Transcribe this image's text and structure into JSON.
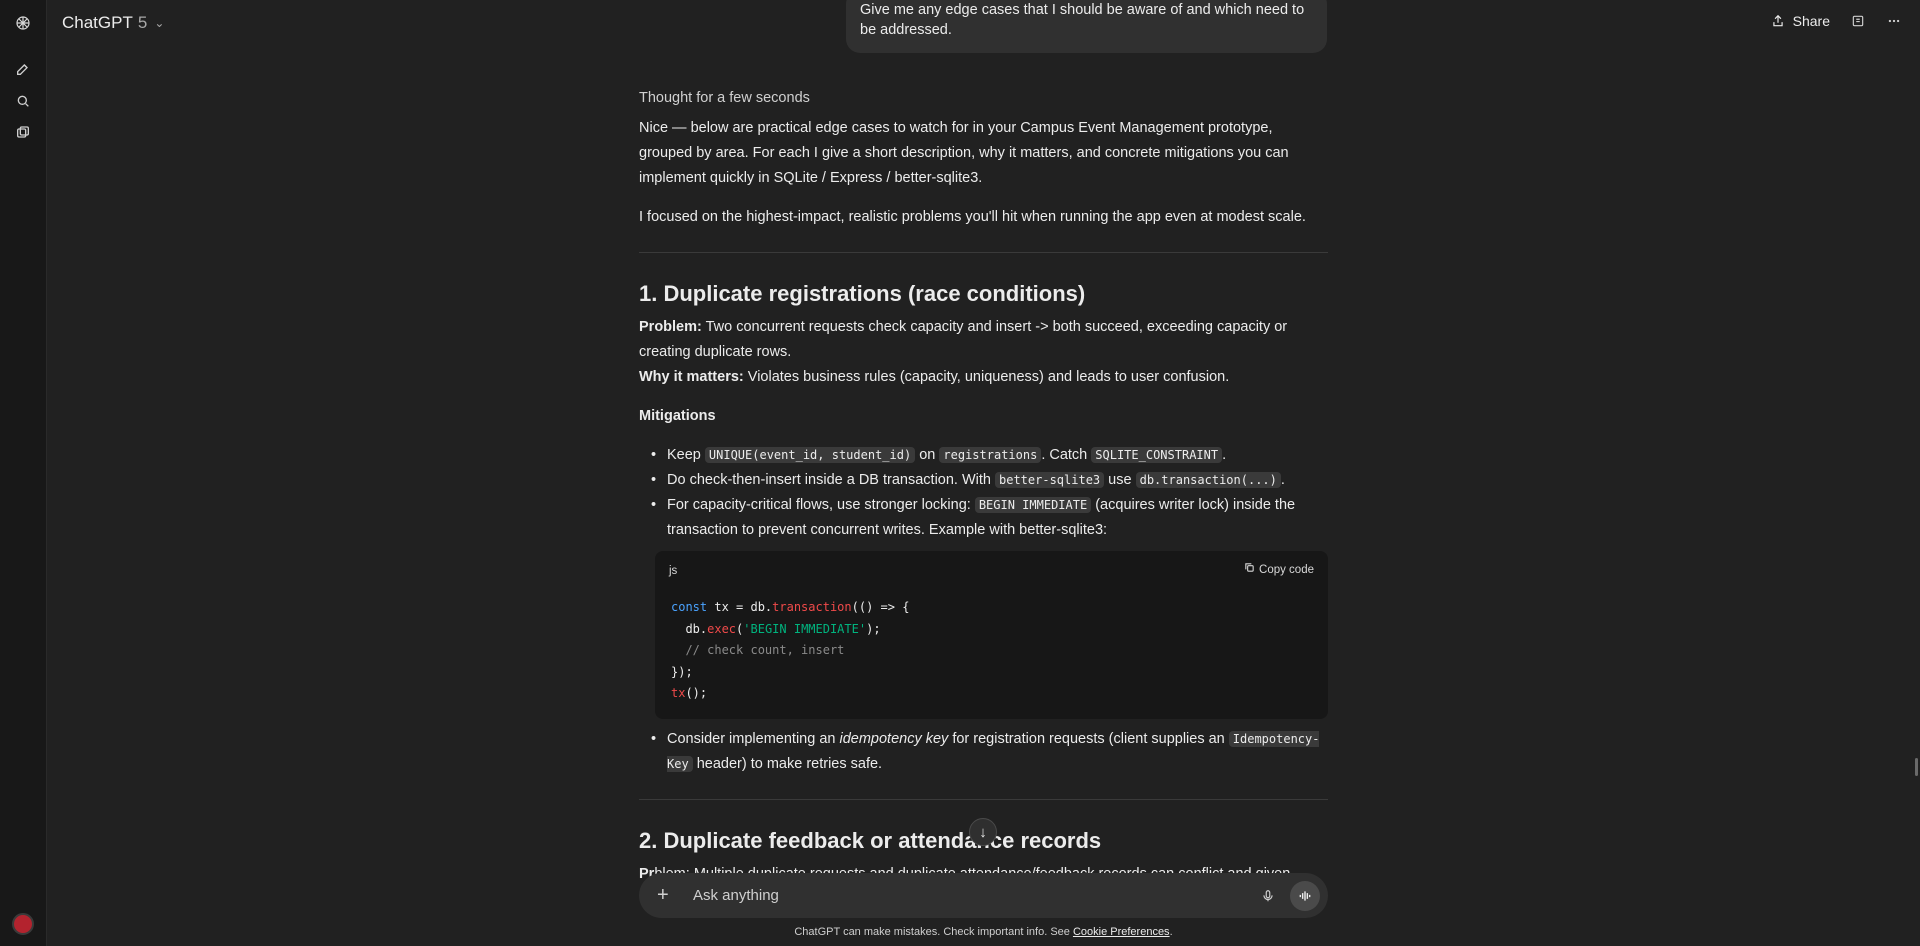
{
  "app": {
    "model_name": "ChatGPT",
    "model_version": "5"
  },
  "topbar": {
    "share_label": "Share"
  },
  "rail": {
    "icons": [
      "logo-icon",
      "new-chat-icon",
      "search-icon",
      "library-icon"
    ]
  },
  "user_message": "Give me any edge cases that I should be aware of and which need to be addressed.",
  "response": {
    "thought": "Thought for a few seconds",
    "intro": "Nice — below are practical edge cases to watch for in your Campus Event Management prototype, grouped by area. For each I give a short description, why it matters, and concrete mitigations you can implement quickly in SQLite / Express / better-sqlite3.",
    "focus": "I focused on the highest-impact, realistic problems you'll hit when running the app even at modest scale.",
    "section1": {
      "title": "1. Duplicate registrations (race conditions)",
      "problem_label": "Problem:",
      "problem_text": " Two concurrent requests check capacity and insert -> both succeed, exceeding capacity or creating duplicate rows.",
      "why_label": "Why it matters:",
      "why_text": " Violates business rules (capacity, uniqueness) and leads to user confusion.",
      "mitigations_label": "Mitigations",
      "b1": {
        "t1": "Keep ",
        "c1": "UNIQUE(event_id, student_id)",
        "t2": " on ",
        "c2": "registrations",
        "t3": ". Catch ",
        "c3": "SQLITE_CONSTRAINT",
        "t4": "."
      },
      "b2": {
        "t1": "Do check-then-insert inside a DB transaction. With ",
        "c1": "better-sqlite3",
        "t2": " use ",
        "c2": "db.transaction(...)",
        "t3": "."
      },
      "b3": {
        "t1": "For capacity-critical flows, use stronger locking: ",
        "c1": "BEGIN IMMEDIATE",
        "t2": " (acquires writer lock) inside the transaction to prevent concurrent writes. Example with better-sqlite3:"
      },
      "code": {
        "lang": "js",
        "copy_label": "Copy code",
        "l1_kw": "const",
        "l1_a": " tx = db.",
        "l1_fn": "transaction",
        "l1_b": "(() => {",
        "l2_a": "  db.",
        "l2_fn": "exec",
        "l2_b": "(",
        "l2_str": "'BEGIN IMMEDIATE'",
        "l2_c": ");",
        "l3_comment": "  // check count, insert",
        "l4": "});",
        "l5_fn": "tx",
        "l5_b": "();"
      },
      "b4": {
        "t1": "Consider implementing an ",
        "em": "idempotency key",
        "t2": " for registration requests (client supplies an ",
        "c1": "Idempotency-Key",
        "t3": " header) to make retries safe."
      }
    },
    "section2": {
      "title": "2. Duplicate feedback or attendance records",
      "partial_label": "Pr",
      "partial_text": "blem: Multiple duplicate requests and duplicate attendance/feedback records can conflict and given"
    }
  },
  "composer": {
    "placeholder": "Ask anything"
  },
  "footer": {
    "text": "ChatGPT can make mistakes. Check important info. See ",
    "link": "Cookie Preferences",
    "end": "."
  }
}
